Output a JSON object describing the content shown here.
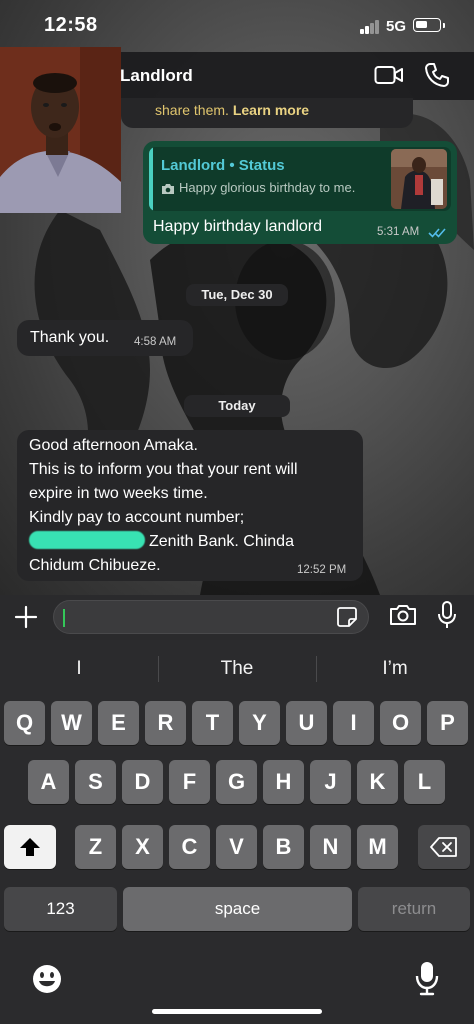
{
  "status_bar": {
    "time": "12:58",
    "network": "5G"
  },
  "header": {
    "contact_name": "Landlord"
  },
  "messages": {
    "info_tail": {
      "text": "share them.",
      "link": "Learn more"
    },
    "reply": {
      "quote_title": "Landlord • Status",
      "quote_text": "Happy glorious birthday to me.",
      "text": "Happy birthday landlord",
      "time": "5:31 AM"
    },
    "date1": "Tue, Dec 30",
    "thanks": {
      "text": "Thank you.",
      "time": "4:58 AM"
    },
    "date2": "Today",
    "notice": {
      "line1": "Good afternoon Amaka.",
      "line2": "This is to inform you that your rent will",
      "line3": "expire in two weeks time.",
      "line4": "Kindly pay to account number;",
      "line5_after": "Zenith Bank. Chinda",
      "line6": "Chidum Chibueze.",
      "time": "12:52 PM"
    }
  },
  "keyboard": {
    "suggestions": [
      "I",
      "The",
      "I’m"
    ],
    "row1": [
      "Q",
      "W",
      "E",
      "R",
      "T",
      "Y",
      "U",
      "I",
      "O",
      "P"
    ],
    "row2": [
      "A",
      "S",
      "D",
      "F",
      "G",
      "H",
      "J",
      "K",
      "L"
    ],
    "row3": [
      "Z",
      "X",
      "C",
      "V",
      "B",
      "N",
      "M"
    ],
    "numbers_label": "123",
    "space_label": "space",
    "return_label": "return"
  },
  "colors": {
    "outgoing_bubble": "#144d37",
    "incoming_bubble": "#262628",
    "quote_accent": "#4ad0c0",
    "read_ticks": "#53bdeb",
    "caret": "#34c759"
  },
  "icons": [
    "video-call-icon",
    "phone-icon",
    "plus-icon",
    "sticker-icon",
    "camera-icon",
    "mic-icon",
    "shift-icon",
    "backspace-icon",
    "emoji-icon"
  ]
}
